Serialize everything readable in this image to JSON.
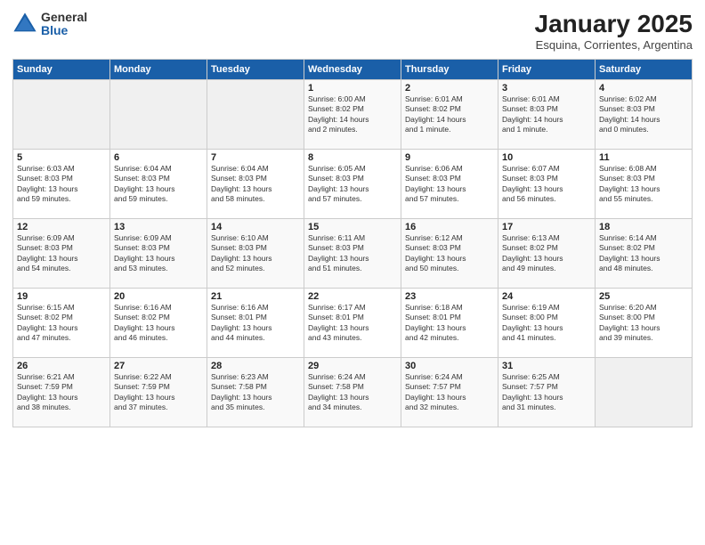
{
  "header": {
    "logo_general": "General",
    "logo_blue": "Blue",
    "month_title": "January 2025",
    "subtitle": "Esquina, Corrientes, Argentina"
  },
  "weekdays": [
    "Sunday",
    "Monday",
    "Tuesday",
    "Wednesday",
    "Thursday",
    "Friday",
    "Saturday"
  ],
  "weeks": [
    [
      {
        "day": "",
        "info": ""
      },
      {
        "day": "",
        "info": ""
      },
      {
        "day": "",
        "info": ""
      },
      {
        "day": "1",
        "info": "Sunrise: 6:00 AM\nSunset: 8:02 PM\nDaylight: 14 hours\nand 2 minutes."
      },
      {
        "day": "2",
        "info": "Sunrise: 6:01 AM\nSunset: 8:02 PM\nDaylight: 14 hours\nand 1 minute."
      },
      {
        "day": "3",
        "info": "Sunrise: 6:01 AM\nSunset: 8:03 PM\nDaylight: 14 hours\nand 1 minute."
      },
      {
        "day": "4",
        "info": "Sunrise: 6:02 AM\nSunset: 8:03 PM\nDaylight: 14 hours\nand 0 minutes."
      }
    ],
    [
      {
        "day": "5",
        "info": "Sunrise: 6:03 AM\nSunset: 8:03 PM\nDaylight: 13 hours\nand 59 minutes."
      },
      {
        "day": "6",
        "info": "Sunrise: 6:04 AM\nSunset: 8:03 PM\nDaylight: 13 hours\nand 59 minutes."
      },
      {
        "day": "7",
        "info": "Sunrise: 6:04 AM\nSunset: 8:03 PM\nDaylight: 13 hours\nand 58 minutes."
      },
      {
        "day": "8",
        "info": "Sunrise: 6:05 AM\nSunset: 8:03 PM\nDaylight: 13 hours\nand 57 minutes."
      },
      {
        "day": "9",
        "info": "Sunrise: 6:06 AM\nSunset: 8:03 PM\nDaylight: 13 hours\nand 57 minutes."
      },
      {
        "day": "10",
        "info": "Sunrise: 6:07 AM\nSunset: 8:03 PM\nDaylight: 13 hours\nand 56 minutes."
      },
      {
        "day": "11",
        "info": "Sunrise: 6:08 AM\nSunset: 8:03 PM\nDaylight: 13 hours\nand 55 minutes."
      }
    ],
    [
      {
        "day": "12",
        "info": "Sunrise: 6:09 AM\nSunset: 8:03 PM\nDaylight: 13 hours\nand 54 minutes."
      },
      {
        "day": "13",
        "info": "Sunrise: 6:09 AM\nSunset: 8:03 PM\nDaylight: 13 hours\nand 53 minutes."
      },
      {
        "day": "14",
        "info": "Sunrise: 6:10 AM\nSunset: 8:03 PM\nDaylight: 13 hours\nand 52 minutes."
      },
      {
        "day": "15",
        "info": "Sunrise: 6:11 AM\nSunset: 8:03 PM\nDaylight: 13 hours\nand 51 minutes."
      },
      {
        "day": "16",
        "info": "Sunrise: 6:12 AM\nSunset: 8:03 PM\nDaylight: 13 hours\nand 50 minutes."
      },
      {
        "day": "17",
        "info": "Sunrise: 6:13 AM\nSunset: 8:02 PM\nDaylight: 13 hours\nand 49 minutes."
      },
      {
        "day": "18",
        "info": "Sunrise: 6:14 AM\nSunset: 8:02 PM\nDaylight: 13 hours\nand 48 minutes."
      }
    ],
    [
      {
        "day": "19",
        "info": "Sunrise: 6:15 AM\nSunset: 8:02 PM\nDaylight: 13 hours\nand 47 minutes."
      },
      {
        "day": "20",
        "info": "Sunrise: 6:16 AM\nSunset: 8:02 PM\nDaylight: 13 hours\nand 46 minutes."
      },
      {
        "day": "21",
        "info": "Sunrise: 6:16 AM\nSunset: 8:01 PM\nDaylight: 13 hours\nand 44 minutes."
      },
      {
        "day": "22",
        "info": "Sunrise: 6:17 AM\nSunset: 8:01 PM\nDaylight: 13 hours\nand 43 minutes."
      },
      {
        "day": "23",
        "info": "Sunrise: 6:18 AM\nSunset: 8:01 PM\nDaylight: 13 hours\nand 42 minutes."
      },
      {
        "day": "24",
        "info": "Sunrise: 6:19 AM\nSunset: 8:00 PM\nDaylight: 13 hours\nand 41 minutes."
      },
      {
        "day": "25",
        "info": "Sunrise: 6:20 AM\nSunset: 8:00 PM\nDaylight: 13 hours\nand 39 minutes."
      }
    ],
    [
      {
        "day": "26",
        "info": "Sunrise: 6:21 AM\nSunset: 7:59 PM\nDaylight: 13 hours\nand 38 minutes."
      },
      {
        "day": "27",
        "info": "Sunrise: 6:22 AM\nSunset: 7:59 PM\nDaylight: 13 hours\nand 37 minutes."
      },
      {
        "day": "28",
        "info": "Sunrise: 6:23 AM\nSunset: 7:58 PM\nDaylight: 13 hours\nand 35 minutes."
      },
      {
        "day": "29",
        "info": "Sunrise: 6:24 AM\nSunset: 7:58 PM\nDaylight: 13 hours\nand 34 minutes."
      },
      {
        "day": "30",
        "info": "Sunrise: 6:24 AM\nSunset: 7:57 PM\nDaylight: 13 hours\nand 32 minutes."
      },
      {
        "day": "31",
        "info": "Sunrise: 6:25 AM\nSunset: 7:57 PM\nDaylight: 13 hours\nand 31 minutes."
      },
      {
        "day": "",
        "info": ""
      }
    ]
  ]
}
